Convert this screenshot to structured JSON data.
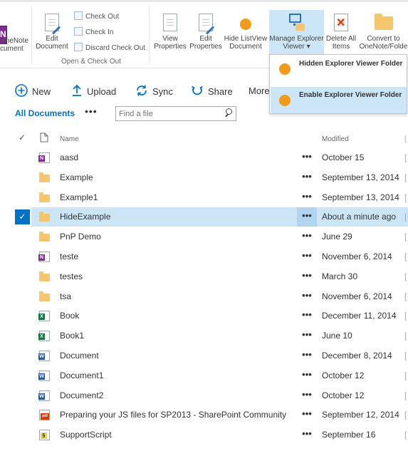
{
  "ribbon": {
    "onenote_label_line1": "OneNote",
    "onenote_label_line2": "cument",
    "edit_document": [
      "Edit",
      "Document"
    ],
    "check_out": "Check Out",
    "check_in": "Check In",
    "discard_check_out": "Discard Check Out",
    "group_label": "Open & Check Out",
    "view_properties": [
      "View",
      "Properties"
    ],
    "edit_properties": [
      "Edit",
      "Properties"
    ],
    "hide_listview": [
      "Hide ListView",
      "Document"
    ],
    "manage_explorer": [
      "Manage Explorer",
      "Viewer ▾"
    ],
    "delete_all": [
      "Delete All",
      "Items"
    ],
    "convert": [
      "Convert to",
      "OneNote/Folde"
    ]
  },
  "dropdown": {
    "items": [
      {
        "label": "Hidden Explorer Viewer Folder",
        "active": false
      },
      {
        "label": "Enable Explorer Viewer Folder",
        "active": true
      }
    ]
  },
  "commands": {
    "new": "New",
    "upload": "Upload",
    "sync": "Sync",
    "share": "Share",
    "more": "More"
  },
  "view": {
    "name": "All Documents",
    "more": "•••",
    "search_placeholder": "Find a file"
  },
  "table": {
    "headers": {
      "name": "Name",
      "modified": "Modified"
    },
    "rows": [
      {
        "name": "aasd",
        "type": "onenote",
        "modified": "October 15",
        "selected": false
      },
      {
        "name": "Example",
        "type": "folder",
        "modified": "September 13, 2014",
        "selected": false
      },
      {
        "name": "Example1",
        "type": "folder",
        "modified": "September 13, 2014",
        "selected": false
      },
      {
        "name": "HideExample",
        "type": "folder",
        "modified": "About a minute ago",
        "selected": true
      },
      {
        "name": "PnP Demo",
        "type": "folder",
        "modified": "June 29",
        "selected": false
      },
      {
        "name": "teste",
        "type": "onenote",
        "modified": "November 6, 2014",
        "selected": false
      },
      {
        "name": "testes",
        "type": "folder",
        "modified": "March 30",
        "selected": false
      },
      {
        "name": "tsa",
        "type": "folder",
        "modified": "November 6, 2014",
        "selected": false
      },
      {
        "name": "Book",
        "type": "excel",
        "modified": "December 11, 2014",
        "selected": false
      },
      {
        "name": "Book1",
        "type": "excel",
        "modified": "June 10",
        "selected": false
      },
      {
        "name": "Document",
        "type": "word",
        "modified": "December 8, 2014",
        "selected": false
      },
      {
        "name": "Document1",
        "type": "word",
        "modified": "October 12",
        "selected": false
      },
      {
        "name": "Document2",
        "type": "word",
        "modified": "October 12",
        "selected": false
      },
      {
        "name": "Preparing your JS files for SP2013 - SharePoint Community",
        "type": "pdf",
        "modified": "September 12, 2014",
        "selected": false
      },
      {
        "name": "SupportScript",
        "type": "script",
        "modified": "September 16",
        "selected": false
      }
    ],
    "row_more": "•••",
    "edge_glyph": "["
  },
  "colors": {
    "accent": "#0072c6",
    "selected_row": "#cde6f7",
    "folder": "#f6c66e",
    "orange": "#f29a1a"
  }
}
